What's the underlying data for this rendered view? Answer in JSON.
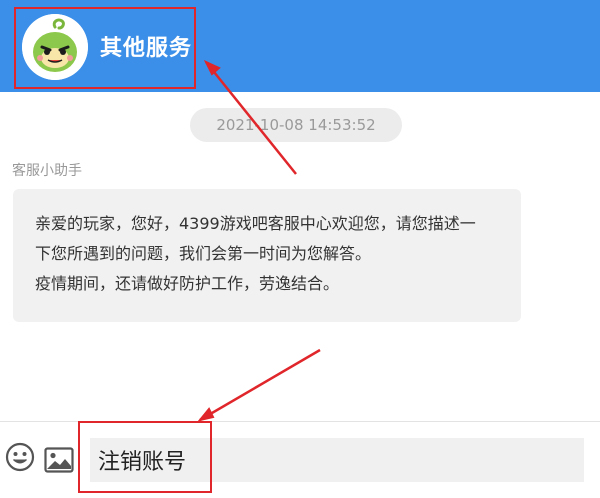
{
  "header": {
    "title": "其他服务",
    "background": "#3c8fe8"
  },
  "chat": {
    "timestamp": "2021-10-08 14:53:52",
    "sender": "客服小助手",
    "message_lines": [
      "亲爱的玩家，您好，4399游戏吧客服中心欢迎您，请您描述一",
      "下您所遇到的问题，我们会第一时间为您解答。",
      "疫情期间，还请做好防护工作，劳逸结合。"
    ]
  },
  "input_bar": {
    "emoji_icon": "emoji-icon",
    "image_icon": "image-icon",
    "message_value": "注销账号"
  },
  "annotations": {
    "color": "#e0262a"
  }
}
